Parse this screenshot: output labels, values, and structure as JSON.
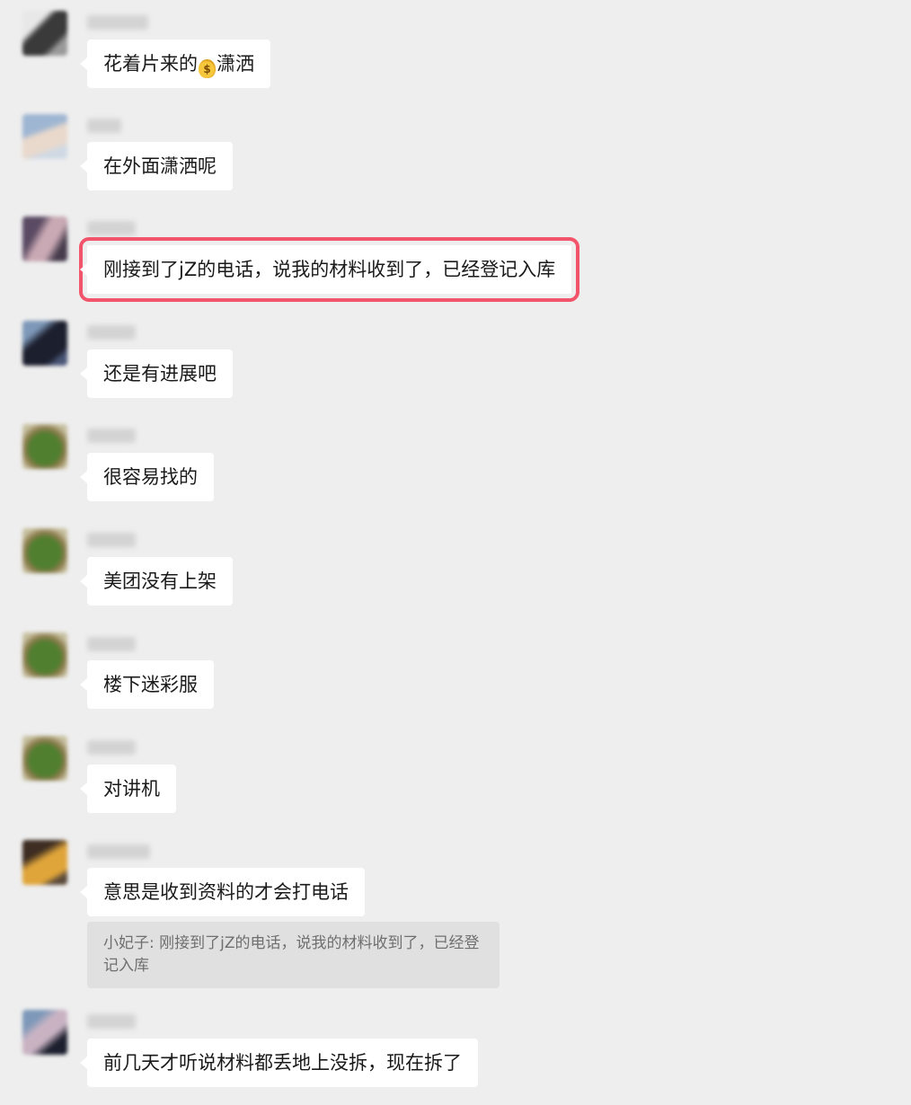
{
  "messages": [
    {
      "text_before": "花着片来的",
      "emoji": "money-bag",
      "text_after": "潇洒"
    },
    {
      "text": "在外面潇洒呢"
    },
    {
      "text": "刚接到了jZ的电话，说我的材料收到了，已经登记入库"
    },
    {
      "text": "还是有进展吧"
    },
    {
      "text": "很容易找的"
    },
    {
      "text": "美团没有上架"
    },
    {
      "text": "楼下迷彩服"
    },
    {
      "text": "对讲机"
    },
    {
      "text": "意思是收到资料的才会打电话"
    },
    {
      "text": "前几天才听说材料都丢地上没拆，现在拆了"
    }
  ],
  "quote": {
    "text": "小妃子: 刚接到了jZ的电话，说我的材料收到了，已经登记入库"
  },
  "colors": {
    "background": "#eeeeee",
    "bubble": "#ffffff",
    "highlight": "#f2556b",
    "quote_bg": "#e0e0e0"
  }
}
